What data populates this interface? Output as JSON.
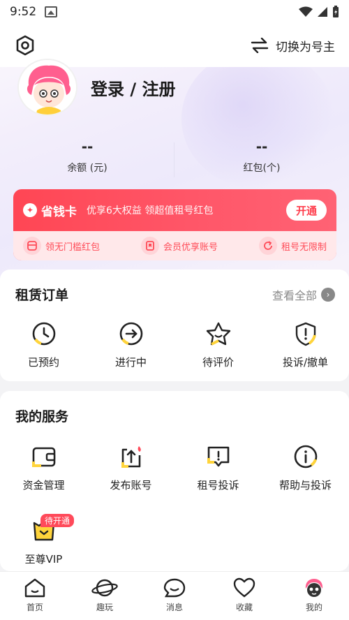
{
  "status_bar": {
    "time": "9:52"
  },
  "header": {
    "switch_label": "切换为号主"
  },
  "profile": {
    "login_label": "登录 / 注册"
  },
  "stats": [
    {
      "value": "--",
      "label": "余额 (元)"
    },
    {
      "value": "--",
      "label": "红包(个)"
    }
  ],
  "vip_card": {
    "badge": "省钱卡",
    "description": "优享6大权益 领超值租号红包",
    "open_label": "开通",
    "benefits": [
      {
        "label": "领无门槛红包",
        "icon": "coupon-icon"
      },
      {
        "label": "会员优享账号",
        "icon": "bookmark-icon"
      },
      {
        "label": "租号无限制",
        "icon": "refresh-icon"
      }
    ]
  },
  "orders": {
    "title": "租赁订单",
    "view_all": "查看全部",
    "items": [
      {
        "label": "已预约",
        "icon": "clock-icon"
      },
      {
        "label": "进行中",
        "icon": "arrow-circle-icon"
      },
      {
        "label": "待评价",
        "icon": "star-icon"
      },
      {
        "label": "投诉/撤单",
        "icon": "shield-alert-icon"
      }
    ]
  },
  "services": {
    "title": "我的服务",
    "items": [
      {
        "label": "资金管理",
        "icon": "wallet-icon"
      },
      {
        "label": "发布账号",
        "icon": "upload-icon"
      },
      {
        "label": "租号投诉",
        "icon": "complaint-icon"
      },
      {
        "label": "帮助与投诉",
        "icon": "info-icon"
      },
      {
        "label": "至尊VIP",
        "icon": "vip-icon"
      }
    ],
    "vip_tag": "待开通"
  },
  "bottom_nav": [
    {
      "label": "首页",
      "icon": "home-icon"
    },
    {
      "label": "趣玩",
      "icon": "planet-icon"
    },
    {
      "label": "消息",
      "icon": "message-icon"
    },
    {
      "label": "收藏",
      "icon": "heart-icon"
    },
    {
      "label": "我的",
      "icon": "profile-icon"
    }
  ],
  "colors": {
    "accent": "#ff4654",
    "yellow": "#ffd43b"
  }
}
